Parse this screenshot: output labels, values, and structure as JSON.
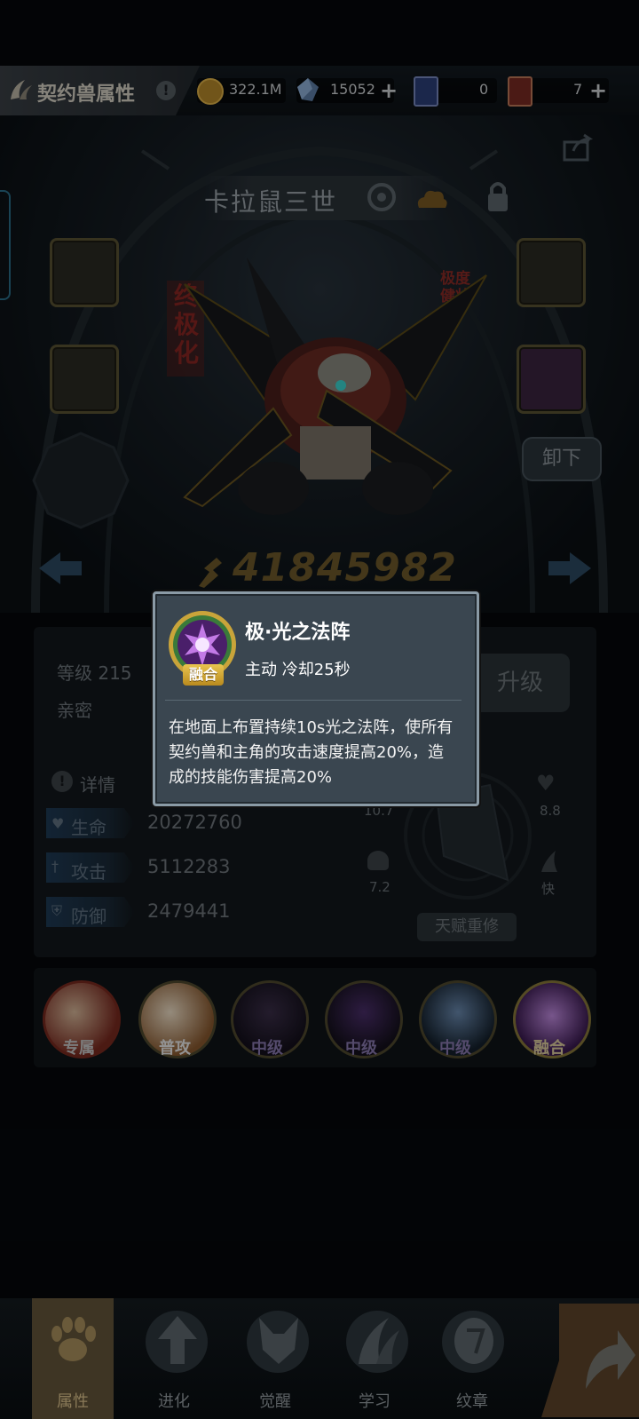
{
  "header": {
    "title": "契约兽属性",
    "info_badge": "!",
    "gold": "322.1M",
    "crystal": "15052",
    "card_blue": "0",
    "card_red": "7",
    "plus": "+"
  },
  "pet": {
    "name": "卡拉鼠三世",
    "evolve_tag": "终极化",
    "trait_tag_line1": "极度",
    "trait_tag_line2": "健壮",
    "unload_label": "卸下",
    "power": "41845982"
  },
  "stats": {
    "level_label": "等级 215",
    "intimacy_label": "亲密",
    "detail_label": "详情",
    "upgrade_label": "升级",
    "rows": [
      {
        "name": "生命",
        "value": "20272760"
      },
      {
        "name": "攻击",
        "value": "5112283"
      },
      {
        "name": "防御",
        "value": "2479441"
      }
    ],
    "radar": {
      "left_top": "10.7",
      "right_top": "8.8",
      "left_bottom": "7.2",
      "right_bottom": "快"
    },
    "reset_label": "天赋重修"
  },
  "skills": [
    {
      "label": "专属",
      "color": "#c0392b"
    },
    {
      "label": "普攻",
      "color": "#d6d6d6"
    },
    {
      "label": "中级",
      "color": "#5a4a8a"
    },
    {
      "label": "中级",
      "color": "#5a4a8a"
    },
    {
      "label": "中级",
      "color": "#5a4a8a"
    },
    {
      "label": "融合",
      "color": "#7a3fa0"
    }
  ],
  "popup": {
    "title": "极·光之法阵",
    "meta": "主动  冷却25秒",
    "badge": "融合",
    "description": "在地面上布置持续10s光之法阵，使所有契约兽和主角的攻击速度提高20%，造成的技能伤害提高20%"
  },
  "nav": [
    {
      "label": "属性",
      "icon": "paw-icon",
      "active": true
    },
    {
      "label": "进化",
      "icon": "arrow-up-icon",
      "active": false
    },
    {
      "label": "觉醒",
      "icon": "fox-icon",
      "active": false
    },
    {
      "label": "学习",
      "icon": "claw-icon",
      "active": false
    },
    {
      "label": "纹章",
      "icon": "emblem-icon",
      "active": false
    }
  ],
  "colors": {
    "accent_gold": "#e9c54f",
    "popup_bg": "#3a4650",
    "power_gold": "#6e5a2a"
  }
}
